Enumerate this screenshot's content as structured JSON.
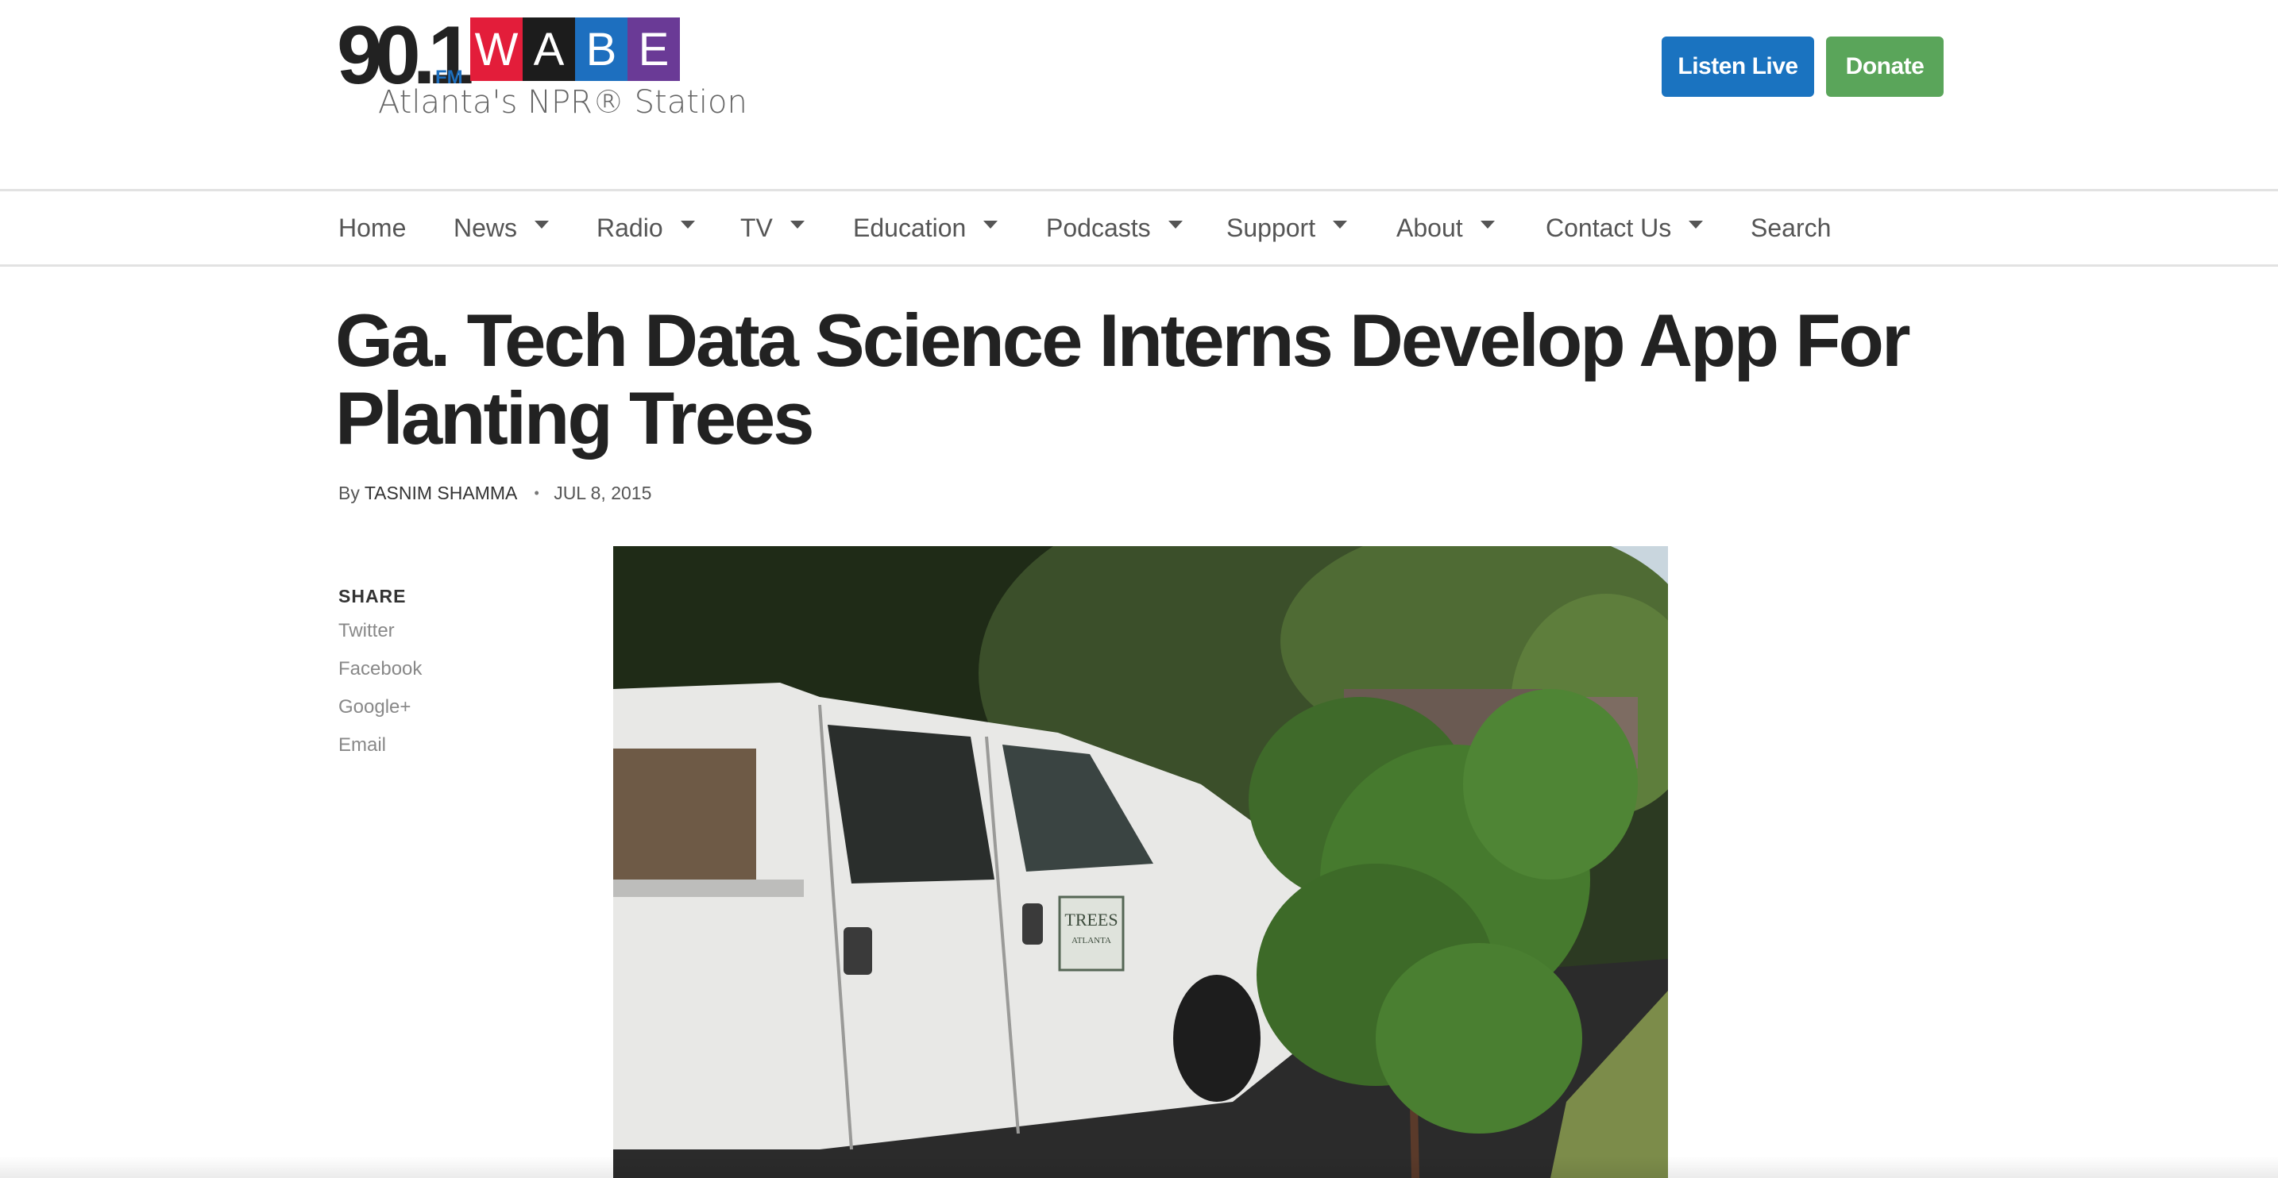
{
  "header": {
    "logo": {
      "frequency": "90.1",
      "band": "FM",
      "letters": [
        "W",
        "A",
        "B",
        "E"
      ],
      "letter_colors": [
        "#e31d3a",
        "#1c1c1c",
        "#1d6fbf",
        "#6a3a96"
      ],
      "tagline": "Atlanta's NPR® Station"
    },
    "listen_live_label": "Listen Live",
    "donate_label": "Donate",
    "listen_color": "#1a73c0",
    "donate_color": "#5aa55a"
  },
  "nav": {
    "items": [
      {
        "label": "Home",
        "dropdown": false
      },
      {
        "label": "News",
        "dropdown": true
      },
      {
        "label": "Radio",
        "dropdown": true
      },
      {
        "label": "TV",
        "dropdown": true
      },
      {
        "label": "Education",
        "dropdown": true
      },
      {
        "label": "Podcasts",
        "dropdown": true
      },
      {
        "label": "Support",
        "dropdown": true
      },
      {
        "label": "About",
        "dropdown": true
      },
      {
        "label": "Contact Us",
        "dropdown": true
      },
      {
        "label": "Search",
        "dropdown": false
      }
    ]
  },
  "article": {
    "title": "Ga. Tech Data Science Interns Develop App For Planting Trees",
    "by_label": "By",
    "author": "TASNIM SHAMMA",
    "date": "JUL 8, 2015",
    "image_sign_text": [
      "TREES",
      "ATLANTA"
    ]
  },
  "share": {
    "title": "SHARE",
    "links": [
      "Twitter",
      "Facebook",
      "Google+",
      "Email"
    ]
  }
}
